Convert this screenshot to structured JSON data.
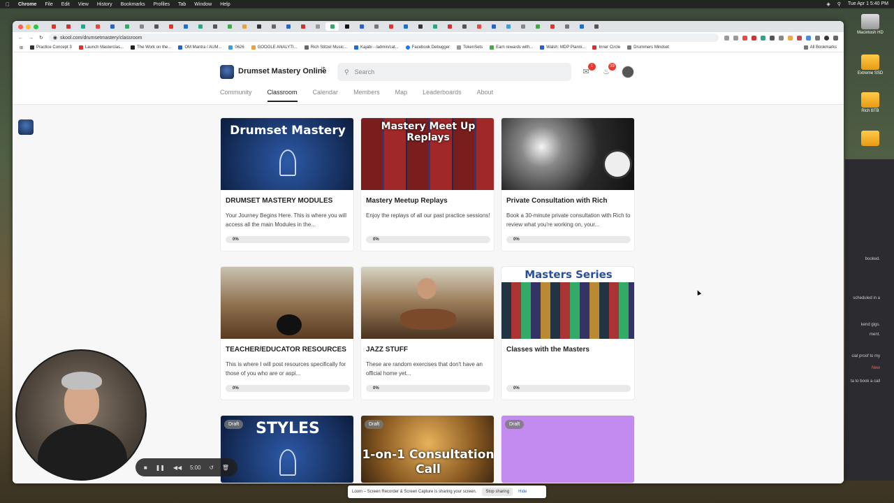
{
  "menubar": {
    "apple": "",
    "app": "Chrome",
    "items": [
      "File",
      "Edit",
      "View",
      "History",
      "Bookmarks",
      "Profiles",
      "Tab",
      "Window",
      "Help"
    ],
    "clock": "Tue Apr 1  5:40 PM"
  },
  "desktop": {
    "drives": [
      "Macintosh HD",
      "Extreme SSD",
      "Rich BTB"
    ],
    "side_text": [
      "booked.",
      "scheduled in a",
      "kend gigs.",
      "ment.",
      "cial proof to my",
      "New",
      "ta to book a call"
    ]
  },
  "browser": {
    "url": "skool.com/drumsetmastery/classroom",
    "bookmarks": [
      "Practice Concept 3",
      "Launch Masterclas...",
      "The Work on the...",
      "OM Mantra / AUM...",
      "0626",
      "GOOGLE ANALYTI...",
      "Rich Stitzel Music...",
      "Kajabi - /admin/cat...",
      "Facebook Debugger",
      "TokenSets",
      "Earn rewards with...",
      "Walsh: MDP Planni...",
      "Inner Circle",
      "Drummers Mindset"
    ],
    "all_bookmarks": "All Bookmarks"
  },
  "header": {
    "group_name": "Drumset Mastery Online",
    "search_placeholder": "Search",
    "chat_badge": "1",
    "notif_badge": "39"
  },
  "nav": {
    "tabs": [
      "Community",
      "Classroom",
      "Calendar",
      "Members",
      "Map",
      "Leaderboards",
      "About"
    ],
    "active": "Classroom"
  },
  "courses": [
    {
      "title": "DRUMSET MASTERY MODULES",
      "desc": "Your Journey Begins Here. This is where you will access all the main Modules in the...",
      "progress": "0%",
      "thumb_text": "Drumset Mastery",
      "draft": ""
    },
    {
      "title": "Mastery Meetup Replays",
      "desc": "Enjoy the replays of all our past practice sessions!",
      "progress": "0%",
      "thumb_text": "Mastery Meet Up Replays",
      "draft": ""
    },
    {
      "title": "Private Consultation with Rich",
      "desc": "Book a 30-minute private consultation with Rich to review what you're working on, your...",
      "progress": "0%",
      "thumb_text": "",
      "draft": ""
    },
    {
      "title": "TEACHER/EDUCATOR RESOURCES",
      "desc": "This is where I will post resources specifically for those of you who are or aspi...",
      "progress": "0%",
      "thumb_text": "",
      "draft": ""
    },
    {
      "title": "JAZZ STUFF",
      "desc": "These are random exercises that don't have an official home yet...",
      "progress": "0%",
      "thumb_text": "",
      "draft": ""
    },
    {
      "title": "Classes with the Masters",
      "desc": "",
      "progress": "0%",
      "thumb_text": "Masters Series",
      "draft": ""
    },
    {
      "title": "",
      "desc": "",
      "progress": "",
      "thumb_text": "STYLES",
      "draft": "Draft"
    },
    {
      "title": "",
      "desc": "",
      "progress": "",
      "thumb_text": "1-on-1 Consultation Call",
      "draft": "Draft"
    },
    {
      "title": "",
      "desc": "",
      "progress": "",
      "thumb_text": "",
      "draft": "Draft"
    }
  ],
  "recorder": {
    "time": "5:00",
    "share_message": "Loom – Screen Recorder & Screen Capture is sharing your screen.",
    "stop_label": "Stop sharing",
    "hide_label": "Hide"
  },
  "colors": {
    "accent": "#222222",
    "badge": "#e63b2e",
    "draft_purple": "#c38bf0"
  }
}
